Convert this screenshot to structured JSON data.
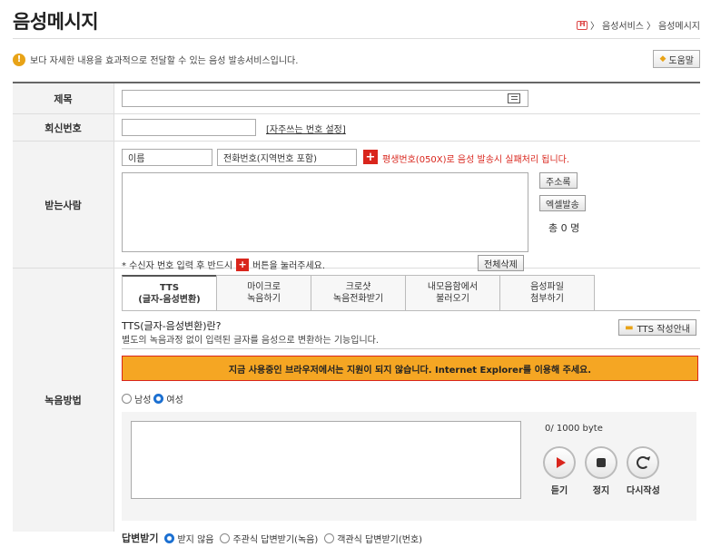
{
  "page": {
    "title": "음성메시지",
    "breadcrumb": [
      "음성서비스",
      "음성메시지"
    ],
    "breadcrumb_sep": "〉",
    "info_text": "보다 자세한 내용을 효과적으로 전달할 수 있는 음성 발송서비스입니다.",
    "help_label": "도움말"
  },
  "rows": {
    "subject_label": "제목",
    "reply_label": "회신번호",
    "reply_link": "[자주쓰는 번호 설정]",
    "recipient_label": "받는사람",
    "record_label": "녹음방법"
  },
  "recipient": {
    "name_value": "이름",
    "phone_value": "전화번호(지역번호 포함)",
    "warning": "평생번호(050X)로 음성 발송시 실패처리 됩니다.",
    "address_book": "주소록",
    "excel_send": "엑셀발송",
    "total_prefix": "총",
    "total_count": "0",
    "total_suffix": "명",
    "notice_before": "* 수신자 번호 입력 후 반드시",
    "notice_after": "버튼을 눌러주세요.",
    "delete_all": "전체삭제"
  },
  "tabs": [
    {
      "line1": "TTS",
      "line2": "(글자-음성변환)",
      "active": true
    },
    {
      "line1": "마이크로",
      "line2": "녹음하기"
    },
    {
      "line1": "크로샷",
      "line2": "녹음전화받기"
    },
    {
      "line1": "내모음함에서",
      "line2": "불러오기"
    },
    {
      "line1": "음성파일",
      "line2": "첨부하기"
    }
  ],
  "tts": {
    "heading": "TTS(글자-음성변환)란?",
    "description": "별도의 녹음과정 없이 입력된 글자를 음성으로 변환하는 기능입니다.",
    "guide_button": "TTS 작성안내",
    "browser_warning": "지금 사용중인 브라우저에서는 지원이 되지 않습니다. Internet Explorer를 이용해 주세요.",
    "voice_male": "남성",
    "voice_female": "여성",
    "byte_count": "0/ 1000 byte",
    "listen": "듣기",
    "stop": "정지",
    "rewrite": "다시작성"
  },
  "reply_options": {
    "label": "답변받기",
    "none": "받지 않음",
    "subjective": "주관식 답변받기(녹음)",
    "objective": "객관식 답변받기(번호)"
  },
  "colors": {
    "warning_bg": "#f5a623",
    "accent_red": "#d9251c",
    "radio_blue": "#1a6fd1"
  }
}
